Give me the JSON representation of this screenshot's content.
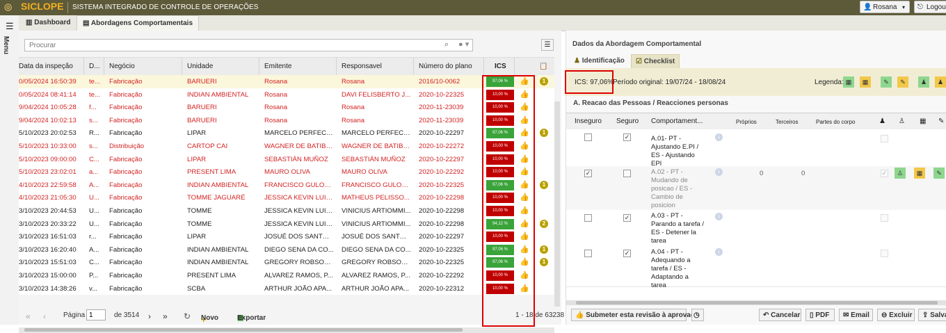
{
  "app": {
    "name": "SICLOPE",
    "subtitle": "SISTEMA INTEGRADO DE CONTROLE DE OPERAÇÕES",
    "user": "Rosana",
    "logout": "Logou"
  },
  "sidebar": {
    "menu_label": "Menu"
  },
  "tabs": [
    {
      "label": "Dashboard"
    },
    {
      "label": "Abordagens Comportamentais"
    }
  ],
  "search": {
    "placeholder": "Procurar"
  },
  "grid": {
    "headers": [
      "Data da inspeção",
      "D...",
      "Negócio",
      "Unidade",
      "Emitente",
      "Responsavel",
      "Número do plano",
      "ICS"
    ],
    "rows": [
      {
        "date": "0/05/2024 16:50:39",
        "d": "te...",
        "negocio": "Fabricação",
        "unidade": "BARUERI",
        "emitente": "Rosana",
        "responsavel": "Rosana",
        "plano": "2016/10-0062",
        "ics": "97,06 %",
        "ics_color": "green",
        "badge": "1",
        "red": true,
        "selected": true
      },
      {
        "date": "0/05/2024 08:41:14",
        "d": "te...",
        "negocio": "Fabricação",
        "unidade": "INDIAN AMBIENTAL",
        "emitente": "Rosana",
        "responsavel": "DAVI FELISBERTO J...",
        "plano": "2020-10-22325",
        "ics": "10,00 %",
        "ics_color": "red",
        "badge": "",
        "red": true,
        "selected": false
      },
      {
        "date": "9/04/2024 10:05:28",
        "d": "f...",
        "negocio": "Fabricação",
        "unidade": "BARUERI",
        "emitente": "Rosana",
        "responsavel": "Rosana",
        "plano": "2020-11-23039",
        "ics": "10,00 %",
        "ics_color": "red",
        "badge": "",
        "red": true,
        "selected": false
      },
      {
        "date": "9/04/2024 10:02:13",
        "d": "s...",
        "negocio": "Fabricação",
        "unidade": "BARUERI",
        "emitente": "Rosana",
        "responsavel": "Rosana",
        "plano": "2020-11-23039",
        "ics": "10,00 %",
        "ics_color": "red",
        "badge": "",
        "red": true,
        "selected": false
      },
      {
        "date": "5/10/2023 20:02:53",
        "d": "R...",
        "negocio": "Fabricação",
        "unidade": "LIPAR",
        "emitente": "MARCELO PERFECTO",
        "responsavel": "MARCELO PERFECTO",
        "plano": "2020-10-22297",
        "ics": "97,06 %",
        "ics_color": "green",
        "badge": "1",
        "red": false,
        "selected": false
      },
      {
        "date": "5/10/2023 10:33:00",
        "d": "s...",
        "negocio": "Distribuição",
        "unidade": "CARTOP CAI",
        "emitente": "WAGNER DE BATIBA...",
        "responsavel": "WAGNER DE BATIBA...",
        "plano": "2020-10-22272",
        "ics": "10,00 %",
        "ics_color": "red",
        "badge": "",
        "red": true,
        "selected": false
      },
      {
        "date": "5/10/2023 09:00:00",
        "d": "C...",
        "negocio": "Fabricação",
        "unidade": "LIPAR",
        "emitente": "SEBASTIÁN MUÑOZ",
        "responsavel": "SEBASTIÁN MUÑOZ",
        "plano": "2020-10-22297",
        "ics": "10,00 %",
        "ics_color": "red",
        "badge": "",
        "red": true,
        "selected": false
      },
      {
        "date": "5/10/2023 23:02:01",
        "d": "a...",
        "negocio": "Fabricação",
        "unidade": "PRESENT LIMA",
        "emitente": "MAURO OLIVA",
        "responsavel": "MAURO OLIVA",
        "plano": "2020-10-22292",
        "ics": "10,00 %",
        "ics_color": "red",
        "badge": "",
        "red": true,
        "selected": false
      },
      {
        "date": "4/10/2023 22:59:58",
        "d": "A...",
        "negocio": "Fabricação",
        "unidade": "INDIAN AMBIENTAL",
        "emitente": "FRANCISCO GULOR...",
        "responsavel": "FRANCISCO GULOR...",
        "plano": "2020-10-22325",
        "ics": "97,06 %",
        "ics_color": "green",
        "badge": "1",
        "red": true,
        "selected": false
      },
      {
        "date": "4/10/2023 21:05:30",
        "d": "U...",
        "negocio": "Fabricação",
        "unidade": "TOMME JAGUARÉ",
        "emitente": "JESSICA KEVIN LUIZ...",
        "responsavel": "MATHEUS PELISSO...",
        "plano": "2020-10-22298",
        "ics": "10,00 %",
        "ics_color": "red",
        "badge": "",
        "red": true,
        "selected": false
      },
      {
        "date": "3/10/2023 20:44:53",
        "d": "U...",
        "negocio": "Fabricação",
        "unidade": "TOMME",
        "emitente": "JESSICA KEVIN LUIZ...",
        "responsavel": "VINICIUS ARTIOMMI...",
        "plano": "2020-10-22298",
        "ics": "10,00 %",
        "ics_color": "red",
        "badge": "",
        "red": false,
        "selected": false
      },
      {
        "date": "3/10/2023 20:33:22",
        "d": "U...",
        "negocio": "Fabricação",
        "unidade": "TOMME",
        "emitente": "JESSICA KEVIN LUIZ...",
        "responsavel": "VINICIUS ARTIOMMI...",
        "plano": "2020-10-22298",
        "ics": "94,12 %",
        "ics_color": "green",
        "badge": "2",
        "red": false,
        "selected": false
      },
      {
        "date": "3/10/2023 16:51:03",
        "d": "r...",
        "negocio": "Fabricação",
        "unidade": "LIPAR",
        "emitente": "JOSUÉ DOS SANTOS...",
        "responsavel": "JOSUÉ DOS SANTOS...",
        "plano": "2020-10-22297",
        "ics": "10,00 %",
        "ics_color": "red",
        "badge": "",
        "red": false,
        "selected": false
      },
      {
        "date": "3/10/2023 16:20:40",
        "d": "A...",
        "negocio": "Fabricação",
        "unidade": "INDIAN AMBIENTAL",
        "emitente": "DIEGO SENA DA CO...",
        "responsavel": "DIEGO SENA DA CO...",
        "plano": "2020-10-22325",
        "ics": "97,06 %",
        "ics_color": "green",
        "badge": "1",
        "red": false,
        "selected": false
      },
      {
        "date": "3/10/2023 15:51:03",
        "d": "C...",
        "negocio": "Fabricação",
        "unidade": "INDIAN AMBIENTAL",
        "emitente": "GREGORY ROBSON ...",
        "responsavel": "GREGORY ROBSON ...",
        "plano": "2020-10-22325",
        "ics": "97,06 %",
        "ics_color": "green",
        "badge": "1",
        "red": false,
        "selected": false
      },
      {
        "date": "3/10/2023 15:00:00",
        "d": "P...",
        "negocio": "Fabricação",
        "unidade": "PRESENT LIMA",
        "emitente": "ALVAREZ RAMOS, P...",
        "responsavel": "ALVAREZ RAMOS, P...",
        "plano": "2020-10-22292",
        "ics": "10,00 %",
        "ics_color": "red",
        "badge": "",
        "red": false,
        "selected": false
      },
      {
        "date": "3/10/2023 14:38:26",
        "d": "v...",
        "negocio": "Fabricação",
        "unidade": "SCBA",
        "emitente": "ARTHUR JOÃO APA...",
        "responsavel": "ARTHUR JOÃO APA...",
        "plano": "2020-10-22312",
        "ics": "10,00 %",
        "ics_color": "red",
        "badge": "",
        "red": false,
        "selected": false
      }
    ]
  },
  "pager": {
    "page_label": "Página",
    "page": "1",
    "of": "de 3514",
    "new": "Novo",
    "export": "Exportar",
    "range": "1 - 18 de 63238"
  },
  "detail": {
    "title": "Dados da Abordagem Comportamental",
    "tabs": [
      {
        "label": "Identificação"
      },
      {
        "label": "Checklist"
      }
    ],
    "ics": "ICS: 97,06%",
    "period": "Período original: 19/07/24 - 18/08/24",
    "legend": "Legenda:",
    "section": "A. Reacao das Pessoas / Reacciones personas",
    "headers": [
      "Inseguro",
      "Seguro",
      "Comportament...",
      "Próprios",
      "Terceiros",
      "Partes do corpo"
    ],
    "items": [
      {
        "text": "A.01- PT - Ajustando E.PI / ES - Ajustando EPI",
        "inseguro": false,
        "seguro": true,
        "proprios": "",
        "terceiros": "",
        "gray": false
      },
      {
        "text": "A.02 - PT - Mudando de posicao / ES - Cambio de posicion",
        "inseguro": true,
        "seguro": false,
        "proprios": "0",
        "terceiros": "0",
        "gray": true
      },
      {
        "text": "A.03 - PT - Parando a tarefa / ES - Detener la tarea",
        "inseguro": false,
        "seguro": true,
        "proprios": "",
        "terceiros": "",
        "gray": false
      },
      {
        "text": "A.04 - PT - Adequando a tarefa / ES - Adaptando a tarea",
        "inseguro": false,
        "seguro": true,
        "proprios": "",
        "terceiros": "",
        "gray": false
      }
    ],
    "buttons": {
      "submit": "Submeter esta revisão à aprovação",
      "cancel": "Cancelar",
      "pdf": "PDF",
      "email": "Email",
      "delete": "Excluir",
      "save": "Salvar"
    }
  }
}
